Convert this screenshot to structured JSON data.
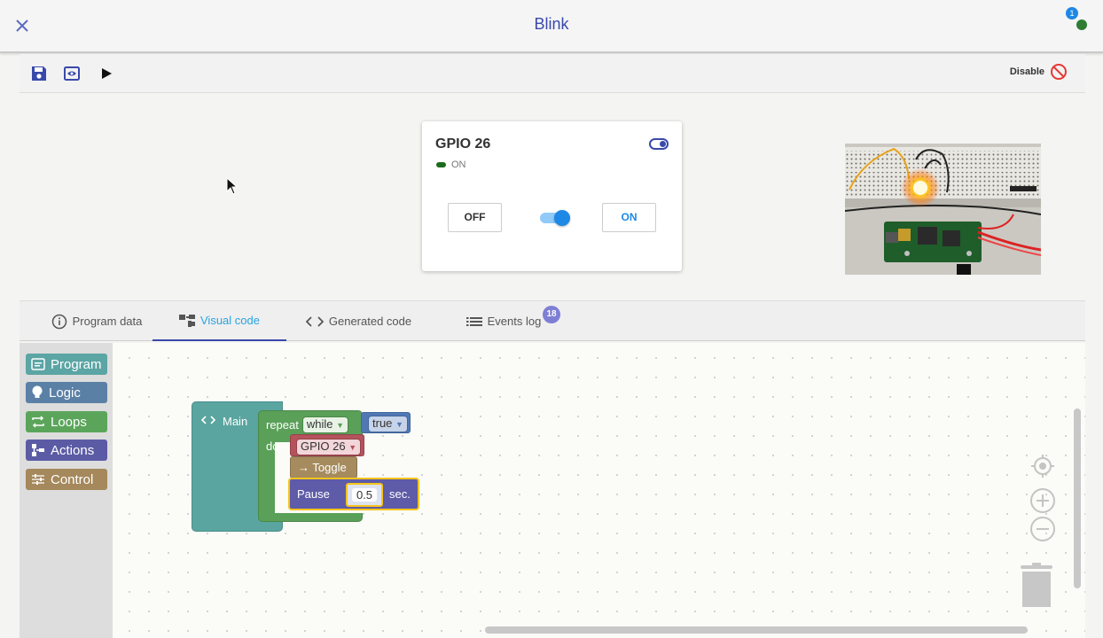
{
  "window": {
    "title": "Blink",
    "notifications_count": "1"
  },
  "toolbar": {
    "disable_label": "Disable"
  },
  "card": {
    "title": "GPIO 26",
    "state_label": "ON",
    "off_label": "OFF",
    "on_label": "ON",
    "switch_checked": true
  },
  "tabs": [
    {
      "label": "Program data"
    },
    {
      "label": "Visual code",
      "active": true
    },
    {
      "label": "Generated code"
    },
    {
      "label": "Events log",
      "badge": "18"
    }
  ],
  "toolbox": {
    "categories": [
      {
        "label": "Program",
        "color": "#5ba5a4"
      },
      {
        "label": "Logic",
        "color": "#5b80a5"
      },
      {
        "label": "Loops",
        "color": "#5ba55b"
      },
      {
        "label": "Actions",
        "color": "#5b5ba5"
      },
      {
        "label": "Control",
        "color": "#a5885b"
      }
    ]
  },
  "blocks": {
    "main_label": "Main",
    "repeat_label": "repeat",
    "while_label": "while",
    "true_label": "true",
    "do_label": "do",
    "gpio_label": "GPIO 26",
    "toggle_label": "Toggle",
    "pause_label": "Pause",
    "pause_value": "0.5",
    "sec_label": "sec."
  },
  "colors": {
    "accent": "#3949ab",
    "active_tab": "#29a3e0",
    "on_blue": "#1e88e5",
    "status_ok": "#2e7d32"
  }
}
